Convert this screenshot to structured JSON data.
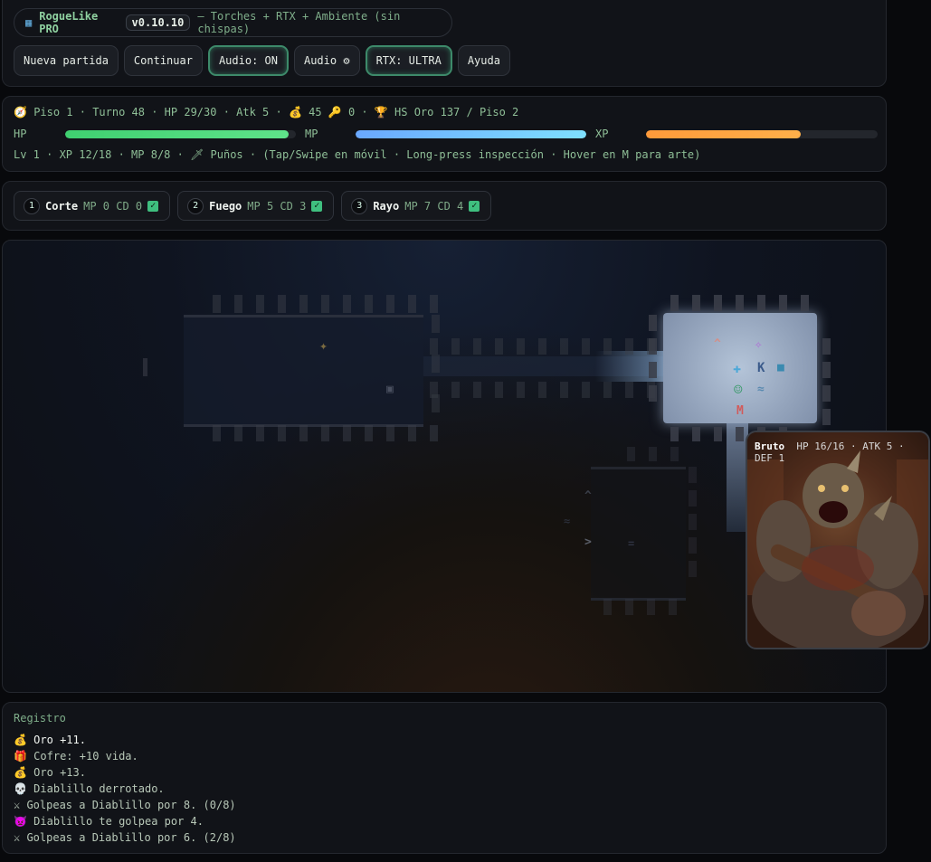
{
  "header": {
    "logo_icon": "map-icon",
    "app_name": "RogueLike PRO",
    "version": "v0.10.10",
    "subtitle": "— Torches + RTX + Ambiente (sin chispas)",
    "buttons": [
      "Nueva partida",
      "Continuar",
      "Audio: ON",
      "Audio ⚙",
      "RTX: ULTRA",
      "Ayuda"
    ]
  },
  "status": {
    "line1": "Piso 1 · Turno 48 · HP 29/30 · Atk 5 · 💰 45 🔑 0 · 🏆 HS Oro 137 / Piso 2",
    "hp_label": "HP",
    "hp_fraction": 0.967,
    "mp_label": "MP",
    "mp_fraction": 1.0,
    "xp_label": "XP",
    "xp_fraction": 0.667,
    "line2": "Lv 1 · XP 12/18 · MP 8/8 · 🗡 Puños · (Tap/Swipe en móvil · Long-press inspección · Hover en M para arte)",
    "colors": {
      "hp": "#5fe38a",
      "mp": "#6fb8ff",
      "xp": "#ffb04a"
    }
  },
  "skills": [
    {
      "num": "1",
      "name": "Corte",
      "meta": "MP 0  CD 0"
    },
    {
      "num": "2",
      "name": "Fuego",
      "meta": "MP 5  CD 3"
    },
    {
      "num": "3",
      "name": "Rayo",
      "meta": "MP 7  CD 4"
    }
  ],
  "map": {
    "glyphs": [
      "✦",
      "▣",
      "^",
      "✧",
      "✚",
      "K",
      "■",
      "≈",
      "M",
      "^",
      "≈",
      ">",
      "="
    ]
  },
  "monster_card": {
    "name": "Bruto",
    "stats": "HP 16/16 · ATK 5 · DEF 1"
  },
  "log": {
    "title": "Registro",
    "entries": [
      "💰 Oro +11.",
      "🎁 Cofre: +10 vida.",
      "💰 Oro +13.",
      "💀 Diablillo derrotado.",
      "⚔ Golpeas a Diablillo por 8. (0/8)",
      "👿 Diablillo te golpea por 4.",
      "⚔ Golpeas a Diablillo por 6. (2/8)"
    ]
  }
}
